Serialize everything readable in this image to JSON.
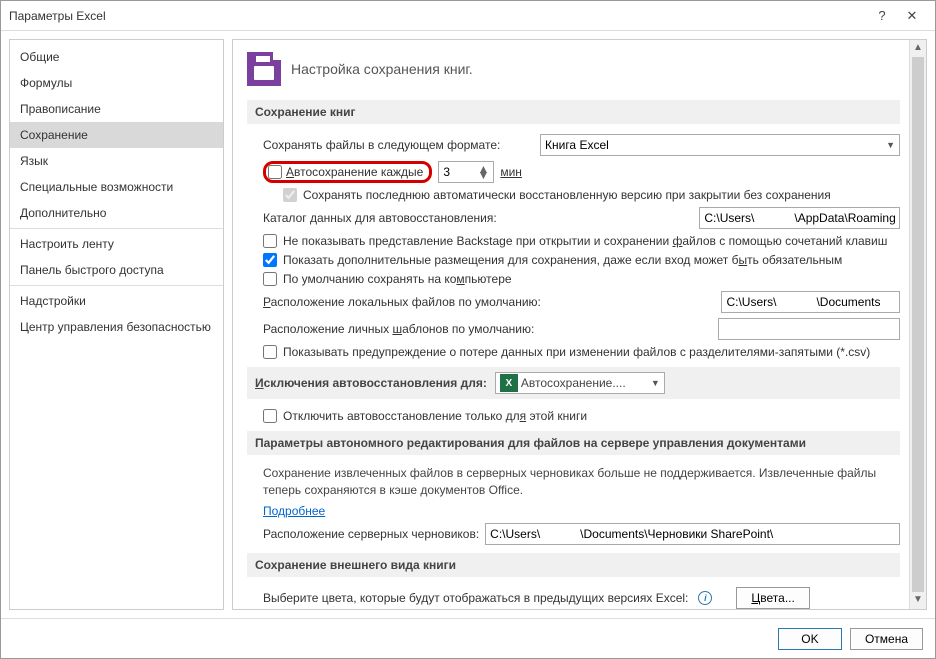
{
  "window": {
    "title": "Параметры Excel"
  },
  "sidebar": {
    "items": [
      {
        "label": "Общие"
      },
      {
        "label": "Формулы"
      },
      {
        "label": "Правописание"
      },
      {
        "label": "Сохранение",
        "selected": true
      },
      {
        "label": "Язык"
      },
      {
        "label": "Специальные возможности"
      },
      {
        "label": "Дополнительно"
      },
      {
        "label": "Настроить ленту"
      },
      {
        "label": "Панель быстрого доступа"
      },
      {
        "label": "Надстройки"
      },
      {
        "label": "Центр управления безопасностью"
      }
    ]
  },
  "header": {
    "text": "Настройка сохранения книг."
  },
  "sections": {
    "save_books": "Сохранение книг",
    "autorecover_exc": "Исключения автовосстановления для:",
    "offline_edit": "Параметры автономного редактирования для файлов на сервере управления документами",
    "appearance": "Сохранение внешнего вида книги"
  },
  "save": {
    "format_label": "Сохранять файлы в следующем формате:",
    "format_value": "Книга Excel",
    "autosave_label": "Автосохранение каждые",
    "autosave_value": "3",
    "autosave_unit": "мин",
    "keep_last_label": "Сохранять последнюю автоматически восстановленную версию при закрытии без сохранения",
    "recover_dir_label": "Каталог данных для автовосстановления:",
    "recover_dir_value": "C:\\Users\\            \\AppData\\Roaming\\Microsoft\\Excel\\",
    "no_backstage_label": "Не показывать представление Backstage при открытии и сохранении файлов с помощью сочетаний клавиш",
    "show_additional_label": "Показать дополнительные размещения для сохранения, даже если вход может быть обязательным",
    "default_save_pc_label": "По умолчанию сохранять на компьютере",
    "local_files_label": "Расположение локальных файлов по умолчанию:",
    "local_files_value": "C:\\Users\\            \\Documents",
    "personal_tpl_label": "Расположение личных шаблонов по умолчанию:",
    "personal_tpl_value": "",
    "csv_warn_label": "Показывать предупреждение о потере данных при изменении файлов с разделителями-запятыми (*.csv)"
  },
  "autorecover": {
    "workbook_value": "Автосохранение....",
    "disable_label": "Отключить автовосстановление только для этой книги"
  },
  "offline": {
    "note": "Сохранение извлеченных файлов в серверных черновиках больше не поддерживается. Извлеченные файлы теперь сохраняются в кэше документов Office.",
    "more_link": "Подробнее",
    "drafts_label": "Расположение серверных черновиков:",
    "drafts_value": "C:\\Users\\            \\Documents\\Черновики SharePoint\\"
  },
  "appearance": {
    "colors_label": "Выберите цвета, которые будут отображаться в предыдущих версиях Excel:",
    "colors_btn": "Цвета..."
  },
  "footer": {
    "ok": "OK",
    "cancel": "Отмена"
  }
}
